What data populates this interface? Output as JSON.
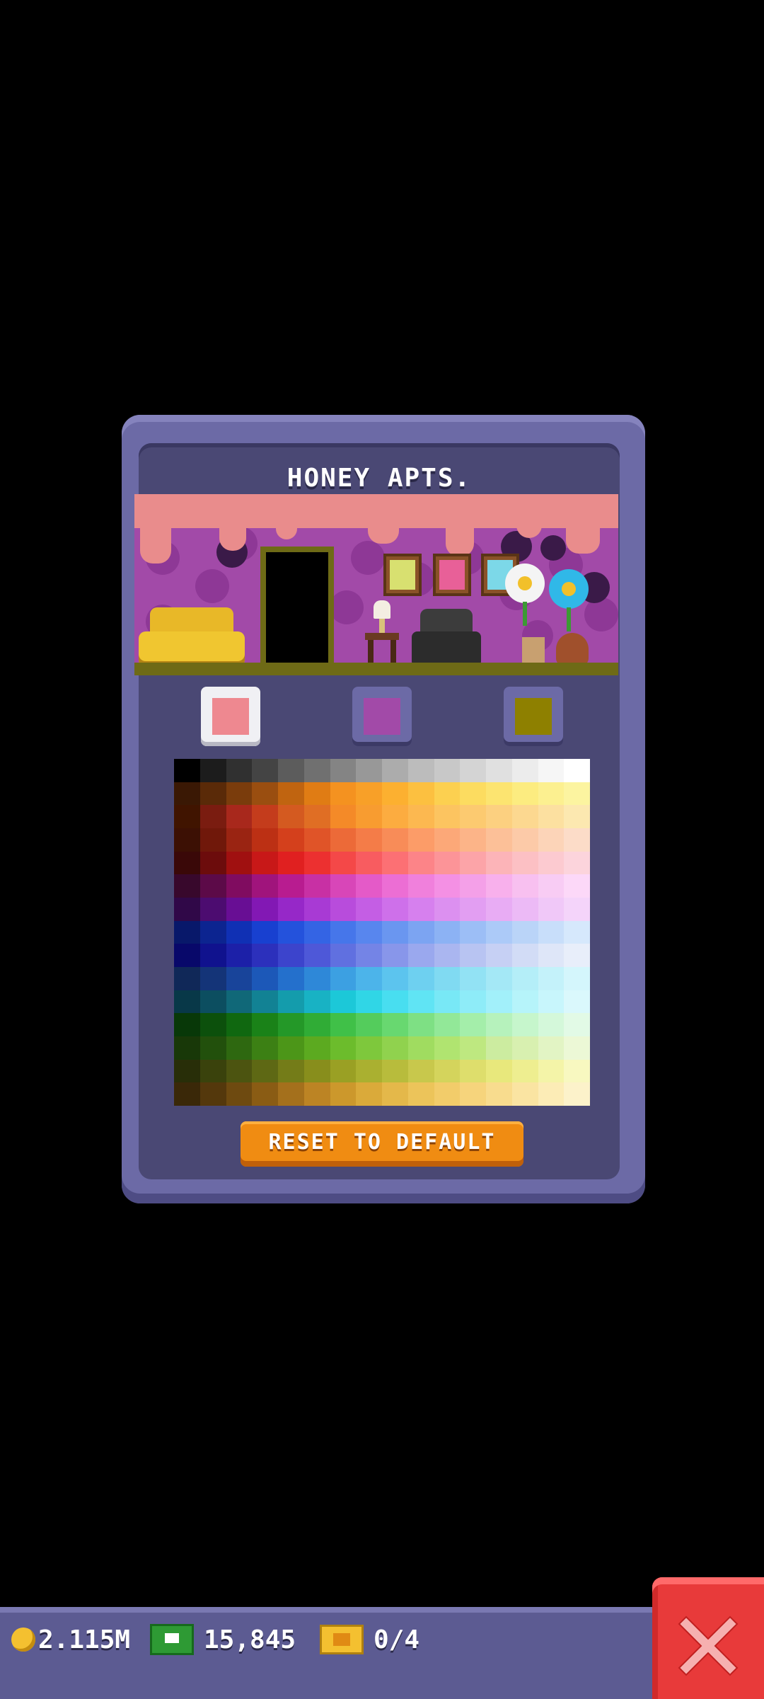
{
  "dialog": {
    "title": "HONEY APTS.",
    "reset_label": "RESET TO DEFAULT"
  },
  "room": {
    "wall_color": "#a24aa8",
    "trim_color": "#e98c8c",
    "floor_color": "#6e6a16"
  },
  "swatches": [
    {
      "name": "trim",
      "color": "#ee8890",
      "selected": true
    },
    {
      "name": "wall",
      "color": "#a24aa8",
      "selected": false
    },
    {
      "name": "floor",
      "color": "#8e8000",
      "selected": false
    }
  ],
  "palette_rows": [
    [
      "#000000",
      "#1c1c1c",
      "#303030",
      "#444444",
      "#5c5c5c",
      "#707070",
      "#848484",
      "#989898",
      "#acacac",
      "#bcbcbc",
      "#c8c8c8",
      "#d4d4d4",
      "#e0e0e0",
      "#ececec",
      "#f6f6f6",
      "#ffffff"
    ],
    [
      "#3a1804",
      "#5a2a08",
      "#7a3c0c",
      "#9a4e10",
      "#c06410",
      "#e07c14",
      "#f49220",
      "#f8a028",
      "#fcb030",
      "#fcc040",
      "#fcd050",
      "#fcdc60",
      "#fce470",
      "#fcec80",
      "#fcf090",
      "#fcf4a0"
    ],
    [
      "#401400",
      "#7a1c10",
      "#a8281c",
      "#c43c1c",
      "#d45a20",
      "#e06e24",
      "#f48a28",
      "#f89c30",
      "#fcac40",
      "#fcb850",
      "#fcc460",
      "#fcca70",
      "#fcd080",
      "#fcd890",
      "#fce0a0",
      "#fce8b0"
    ],
    [
      "#3c1004",
      "#70180a",
      "#9a2412",
      "#bc3014",
      "#d4401c",
      "#e05428",
      "#ec6a38",
      "#f47c48",
      "#f88c58",
      "#fc9c68",
      "#fca878",
      "#fcb488",
      "#fcc098",
      "#fccaa8",
      "#fcd4b8",
      "#fcdcc8"
    ],
    [
      "#3a0808",
      "#6c0c0c",
      "#a01010",
      "#c81818",
      "#e02020",
      "#ec3030",
      "#f44848",
      "#f85c60",
      "#fc7074",
      "#fc8488",
      "#fc9498",
      "#fca4a8",
      "#fcb4b8",
      "#fcc0c4",
      "#fccad0",
      "#fcd4dc"
    ],
    [
      "#38082c",
      "#5c0a48",
      "#800c60",
      "#a0147c",
      "#b81c90",
      "#c830a4",
      "#d846b8",
      "#e45ac8",
      "#ec6ed4",
      "#f080dc",
      "#f490e4",
      "#f4a0e8",
      "#f8b0ec",
      "#f8c0f0",
      "#f8ccf4",
      "#fcd8f8"
    ],
    [
      "#300848",
      "#4c0c70",
      "#680e94",
      "#8218b4",
      "#9628c8",
      "#a83ad4",
      "#b84cdc",
      "#c45ee4",
      "#ce70ea",
      "#d680ee",
      "#dc90f0",
      "#e29ef2",
      "#e8acf4",
      "#ecbaf6",
      "#f0c8f8",
      "#f4d4fa"
    ],
    [
      "#08186a",
      "#0c2490",
      "#1030b4",
      "#1840d0",
      "#2452dc",
      "#3464e4",
      "#4676ea",
      "#5886ee",
      "#6a96f0",
      "#7ca4f2",
      "#8cb2f4",
      "#9cbef6",
      "#accaf8",
      "#bad4f8",
      "#c8defa",
      "#d6e8fc"
    ],
    [
      "#08086a",
      "#10128e",
      "#1c20a8",
      "#2c30bc",
      "#3c44cc",
      "#4e58d8",
      "#6070e0",
      "#7484e6",
      "#8896ea",
      "#9aa8ee",
      "#aab6f0",
      "#b8c4f2",
      "#c6d0f4",
      "#d2dcf6",
      "#dee6f8",
      "#e8eefa"
    ],
    [
      "#102858",
      "#143478",
      "#18449a",
      "#1c58b8",
      "#2470cc",
      "#2e88d8",
      "#3ca0e2",
      "#4cb4ea",
      "#5cc4ee",
      "#6ed0f0",
      "#80daf2",
      "#92e2f4",
      "#a4e8f6",
      "#b4eef8",
      "#c4f2fa",
      "#d4f6fc"
    ],
    [
      "#083848",
      "#0c4e60",
      "#106878",
      "#128294",
      "#149cac",
      "#18b2c4",
      "#1cc8d8",
      "#30d6e6",
      "#48def0",
      "#60e4f4",
      "#78e8f6",
      "#8eecf8",
      "#a2f0fa",
      "#b6f4fa",
      "#c8f6fc",
      "#daf8fc"
    ],
    [
      "#083808",
      "#0c500c",
      "#106810",
      "#1a8218",
      "#249828",
      "#30ac36",
      "#40c048",
      "#54cc5c",
      "#68d870",
      "#7ee084",
      "#92e898",
      "#a4eeaa",
      "#b6f2bc",
      "#c6f6cc",
      "#d4f8da",
      "#e2fae6"
    ],
    [
      "#183808",
      "#22500c",
      "#2e6810",
      "#3c8014",
      "#4c9618",
      "#5caa20",
      "#6cbc2c",
      "#7ec83c",
      "#90d24e",
      "#a0dc60",
      "#b0e470",
      "#bee880",
      "#cceca0",
      "#d8f0b0",
      "#e2f4c4",
      "#ecf8d6"
    ],
    [
      "#282e08",
      "#3a420c",
      "#4c5410",
      "#5e6814",
      "#747c18",
      "#888e1c",
      "#9aa024",
      "#aab030",
      "#b8bc3c",
      "#c8c84c",
      "#d4d45c",
      "#dede6c",
      "#e8e87c",
      "#eeee90",
      "#f4f4a8",
      "#f8f8c0"
    ],
    [
      "#3a2808",
      "#54380c",
      "#6e4a10",
      "#8a5c14",
      "#a4701c",
      "#bc8424",
      "#cc982c",
      "#daaa3a",
      "#e4b84a",
      "#ecc45a",
      "#f2cc6a",
      "#f6d47c",
      "#f8dc8e",
      "#fae4a2",
      "#fcecb6",
      "#fcf2ca"
    ]
  ],
  "status_bar": {
    "coins": "2.115M",
    "bux": "15,845",
    "tickets": "0/4",
    "coin_color": "#f4c030",
    "bux_color": "#2e9a34",
    "close_color": "#e83a3a"
  }
}
